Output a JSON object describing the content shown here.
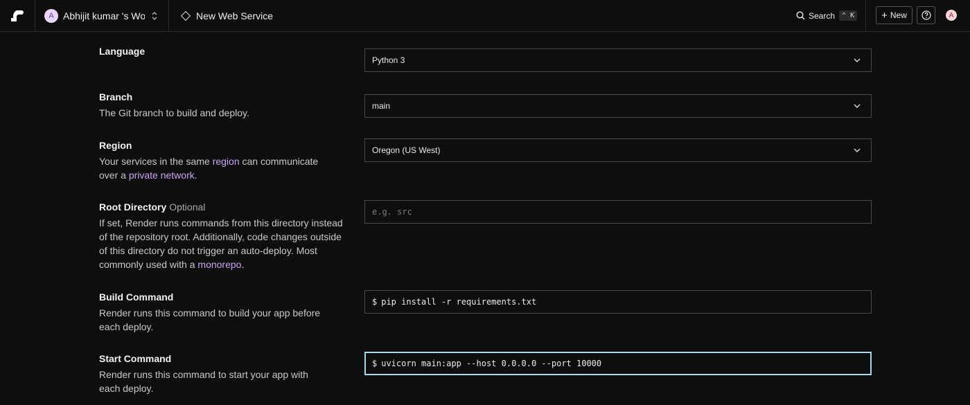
{
  "header": {
    "workspace": {
      "avatar_initial": "A",
      "name": "Abhijit kumar 's Wo..."
    },
    "breadcrumb": "New Web Service",
    "search": {
      "label": "Search",
      "shortcut": "⌃ K"
    },
    "new_button": "New",
    "user_avatar_initial": "A"
  },
  "form": {
    "language": {
      "title": "Language",
      "value": "Python 3"
    },
    "branch": {
      "title": "Branch",
      "desc": "The Git branch to build and deploy.",
      "value": "main"
    },
    "region": {
      "title": "Region",
      "desc_pre": "Your services in the same ",
      "desc_link1": "region",
      "desc_mid": " can communicate over a ",
      "desc_link2": "private network",
      "desc_post": ".",
      "value": "Oregon (US West)"
    },
    "root_directory": {
      "title": "Root Directory",
      "optional": "Optional",
      "desc_pre": "If set, Render runs commands from this directory instead of the repository root. Additionally, code changes outside of this directory do not trigger an auto-deploy. Most commonly used with a ",
      "desc_link": "monorepo",
      "desc_post": ".",
      "placeholder": "e.g. src"
    },
    "build_command": {
      "title": "Build Command",
      "desc": "Render runs this command to build your app before each deploy.",
      "prefix": "$",
      "value": "pip install -r requirements.txt"
    },
    "start_command": {
      "title": "Start Command",
      "desc": "Render runs this command to start your app with each deploy.",
      "prefix": "$",
      "value": "uvicorn main:app --host 0.0.0.0 --port 10000"
    }
  },
  "colors": {
    "background": "#0e0e0e",
    "link": "#c9a6f5",
    "focus_border": "#a8d8ec"
  }
}
